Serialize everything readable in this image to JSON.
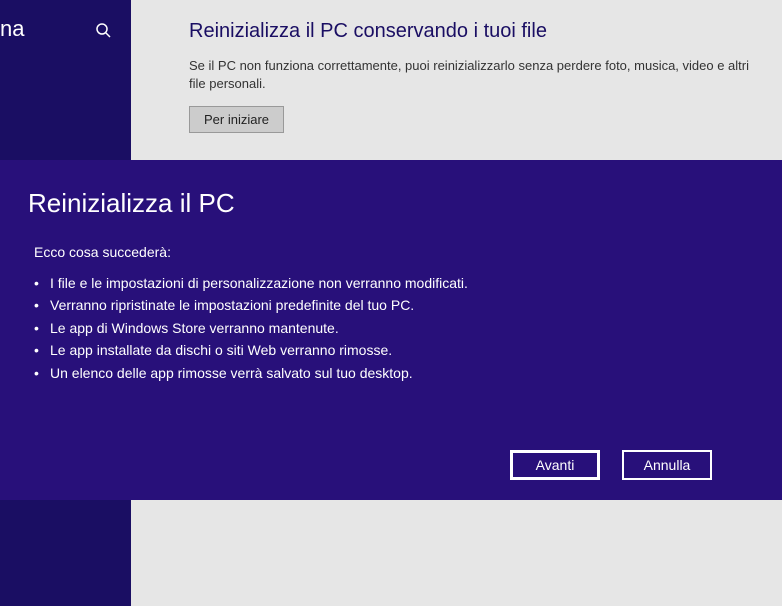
{
  "sidebar": {
    "label_fragment": "na"
  },
  "content": {
    "title": "Reinizializza il PC conservando i tuoi file",
    "description": "Se il PC non funziona correttamente, puoi reinizializzarlo senza perdere foto, musica, video e altri file personali.",
    "start_button": "Per iniziare"
  },
  "dialog": {
    "title": "Reinizializza il PC",
    "subtitle": "Ecco cosa succederà:",
    "items": [
      "I file e le impostazioni di personalizzazione non verranno modificati.",
      "Verranno ripristinate le impostazioni predefinite del tuo PC.",
      "Le app di Windows Store verranno mantenute.",
      "Le app installate da dischi o siti Web verranno rimosse.",
      "Un elenco delle app rimosse verrà salvato sul tuo desktop."
    ],
    "next_button": "Avanti",
    "cancel_button": "Annulla"
  }
}
